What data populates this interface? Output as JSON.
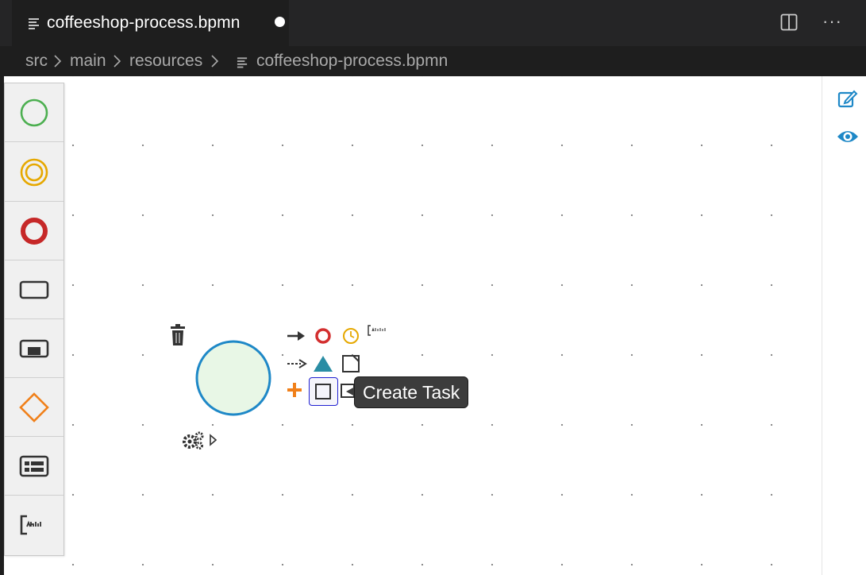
{
  "tab": {
    "filename": "coffeeshop-process.bpmn",
    "unsaved": true,
    "icon": "file-lines-icon"
  },
  "editor_actions": {
    "split_icon": "split-editor-icon",
    "more_label": "···"
  },
  "breadcrumb": {
    "segments": [
      "src",
      "main",
      "resources"
    ],
    "file": "coffeeshop-process.bpmn",
    "separator": "›"
  },
  "palette": {
    "items": [
      {
        "tool": "start-event",
        "icon": "circle-thin-icon",
        "color": "#4caf50"
      },
      {
        "tool": "intermediate-event",
        "icon": "double-circle-icon",
        "color": "#e6a800"
      },
      {
        "tool": "end-event",
        "icon": "circle-thick-icon",
        "color": "#c62828"
      },
      {
        "tool": "task",
        "icon": "rounded-rect-icon",
        "color": "#333333"
      },
      {
        "tool": "subprocess",
        "icon": "subprocess-icon",
        "color": "#333333"
      },
      {
        "tool": "gateway",
        "icon": "diamond-icon",
        "color": "#f0801a"
      },
      {
        "tool": "data-form",
        "icon": "form-icon",
        "color": "#333333"
      },
      {
        "tool": "annotation",
        "icon": "text-annotation-icon",
        "color": "#333333"
      }
    ]
  },
  "canvas": {
    "start_event": {
      "fill": "#e8f7e6",
      "stroke": "#1e88c7"
    },
    "selected_task_outline": "#1f1fd1"
  },
  "tooltip": {
    "text": "Create Task"
  },
  "side_actions": {
    "edit_icon": "edit-icon",
    "preview_icon": "eye-icon",
    "color": "#1e88c7"
  }
}
